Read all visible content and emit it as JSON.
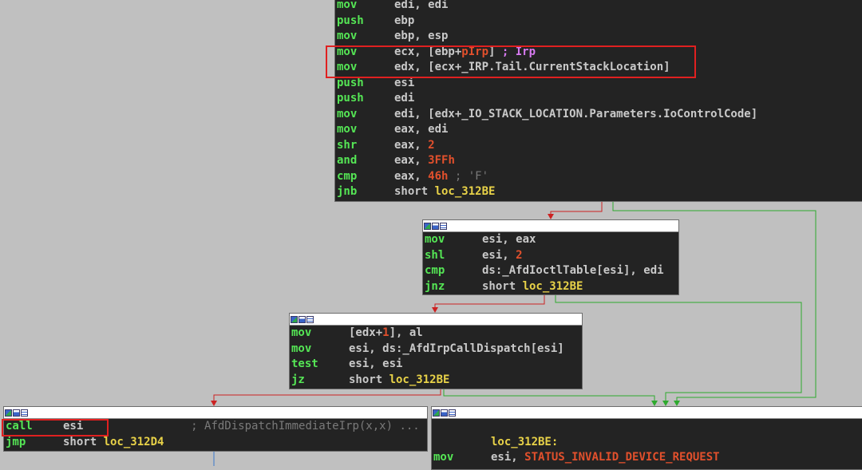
{
  "colors": {
    "background": "#c0c0c0",
    "block_bg": "#232323",
    "mnemonic": "#55e655",
    "register": "#c9c9c9",
    "immediate": "#e2502c",
    "label": "#e8d248",
    "comment": "#7a7a7a",
    "argument": "#d77af0",
    "edge_true": "#2eaa2e",
    "edge_false": "#cc2222",
    "edge_jump": "#3a78cc",
    "highlight_box": "#e02020"
  },
  "titlebar_icons": [
    "graph-overview-icon",
    "graph-view-icon",
    "text-view-icon"
  ],
  "blocks": {
    "b1": {
      "lines": [
        {
          "m": "mov",
          "ops": [
            [
              "reg",
              "edi, edi"
            ]
          ]
        },
        {
          "m": "push",
          "ops": [
            [
              "reg",
              "ebp"
            ]
          ]
        },
        {
          "m": "mov",
          "ops": [
            [
              "reg",
              "ebp, esp"
            ]
          ]
        },
        {
          "m": "mov",
          "ops": [
            [
              "reg",
              "ecx, [ebp+"
            ],
            [
              "num",
              "pIrp"
            ],
            [
              "reg",
              "] "
            ],
            [
              "sym",
              "; Irp"
            ]
          ]
        },
        {
          "m": "mov",
          "ops": [
            [
              "reg",
              "edx, [ecx+_IRP.Tail.CurrentStackLocation]"
            ]
          ]
        },
        {
          "m": "push",
          "ops": [
            [
              "reg",
              "esi"
            ]
          ]
        },
        {
          "m": "push",
          "ops": [
            [
              "reg",
              "edi"
            ]
          ]
        },
        {
          "m": "mov",
          "ops": [
            [
              "reg",
              "edi, [edx+_IO_STACK_LOCATION.Parameters.IoControlCode]"
            ]
          ]
        },
        {
          "m": "mov",
          "ops": [
            [
              "reg",
              "eax, edi"
            ]
          ]
        },
        {
          "m": "shr",
          "ops": [
            [
              "reg",
              "eax, "
            ],
            [
              "num",
              "2"
            ]
          ]
        },
        {
          "m": "and",
          "ops": [
            [
              "reg",
              "eax, "
            ],
            [
              "num",
              "3FFh"
            ]
          ]
        },
        {
          "m": "cmp",
          "ops": [
            [
              "reg",
              "eax, "
            ],
            [
              "num",
              "46h"
            ],
            [
              "cmt",
              " ; 'F'"
            ]
          ]
        },
        {
          "m": "jnb",
          "ops": [
            [
              "reg",
              "short "
            ],
            [
              "lbl",
              "loc_312BE"
            ]
          ]
        }
      ]
    },
    "b2": {
      "lines": [
        {
          "m": "mov",
          "ops": [
            [
              "reg",
              "esi, eax"
            ]
          ]
        },
        {
          "m": "shl",
          "ops": [
            [
              "reg",
              "esi, "
            ],
            [
              "num",
              "2"
            ]
          ]
        },
        {
          "m": "cmp",
          "ops": [
            [
              "reg",
              "ds:_AfdIoctlTable[esi], edi"
            ]
          ]
        },
        {
          "m": "jnz",
          "ops": [
            [
              "reg",
              "short "
            ],
            [
              "lbl",
              "loc_312BE"
            ]
          ]
        }
      ]
    },
    "b3": {
      "lines": [
        {
          "m": "mov",
          "ops": [
            [
              "reg",
              "[edx+"
            ],
            [
              "num",
              "1"
            ],
            [
              "reg",
              "], al"
            ]
          ]
        },
        {
          "m": "mov",
          "ops": [
            [
              "reg",
              "esi, ds:_AfdIrpCallDispatch[esi]"
            ]
          ]
        },
        {
          "m": "test",
          "ops": [
            [
              "reg",
              "esi, esi"
            ]
          ]
        },
        {
          "m": "jz",
          "ops": [
            [
              "reg",
              "short "
            ],
            [
              "lbl",
              "loc_312BE"
            ]
          ]
        }
      ]
    },
    "b4": {
      "lines": [
        {
          "m": "call",
          "ops": [
            [
              "reg",
              "esi"
            ],
            [
              "cmt",
              "                ; AfdDispatchImmediateIrp(x,x) ..."
            ]
          ]
        },
        {
          "m": "jmp",
          "ops": [
            [
              "reg",
              "short "
            ],
            [
              "lbl",
              "loc_312D4"
            ]
          ]
        }
      ]
    },
    "b5": {
      "lines": [
        {
          "m": "",
          "ops": []
        },
        {
          "m": "",
          "ops": [
            [
              "lbl",
              "loc_312BE:"
            ]
          ]
        },
        {
          "m": "mov",
          "ops": [
            [
              "reg",
              "esi, "
            ],
            [
              "num",
              "STATUS_INVALID_DEVICE_REQUEST"
            ]
          ]
        }
      ]
    }
  }
}
